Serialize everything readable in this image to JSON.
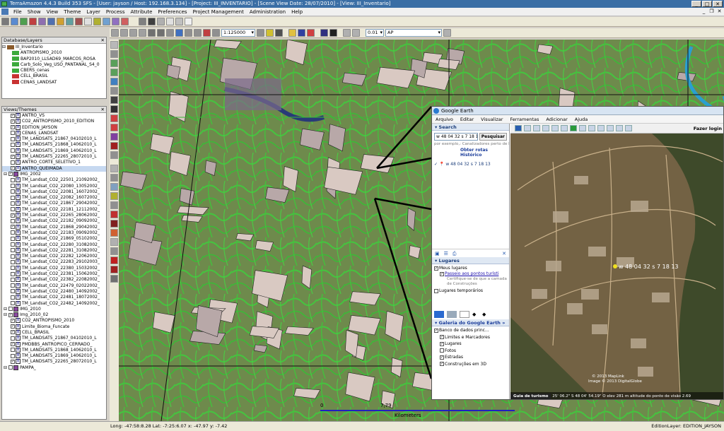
{
  "app": {
    "title": "TerraAmazon 4.4.3 Build 353 SFS - [User: jayson / Host: 192.168.3.134] - [Project: III_INVENTARIO] - [Scene View Date: 28/07/2010] - [View: III_Inventario]",
    "window_buttons": [
      "_",
      "□",
      "✕"
    ],
    "mdi_buttons": [
      "_",
      "❐",
      "✕"
    ]
  },
  "menu": [
    "File",
    "Show",
    "View",
    "Theme",
    "Layer",
    "Process",
    "Attribute",
    "Preferences",
    "Project Management",
    "Administration",
    "Help"
  ],
  "toolbar": {
    "scale": "1:125000",
    "step": "0.01",
    "state": "AP"
  },
  "database_panel": {
    "title": "Database/Layers",
    "close": "✕",
    "root": "III_Inventario",
    "layers": [
      "ANTROPISMO_2010",
      "BAP2010_LLSAD69_MARCOS_ROSA",
      "Carb_Solo_Veg_USO_PANTANAL_S4_0",
      "CBERS_cenas",
      "CELL_BRASIL",
      "CENAS_LANDSAT"
    ]
  },
  "views_panel": {
    "title": "Views/Themes",
    "close": "✕",
    "themes": [
      {
        "label": "ANTRO_VS",
        "checked": true,
        "indent": 1
      },
      {
        "label": "CO2_ANTROPISMO_2010_EDITION",
        "checked": true,
        "indent": 1
      },
      {
        "label": "EDITION_JAYSON",
        "checked": true,
        "indent": 1
      },
      {
        "label": "CENAS_LANDSAT",
        "checked": false,
        "indent": 1
      },
      {
        "label": "TM_LANDSAT5_21867_04102010_L",
        "checked": false,
        "indent": 1
      },
      {
        "label": "TM_LANDSAT5_21868_14062010_L",
        "checked": false,
        "indent": 1
      },
      {
        "label": "TM_LANDSAT5_21869_14062010_L",
        "checked": false,
        "indent": 1
      },
      {
        "label": "TM_LANDSAT5_22265_28072010_L",
        "checked": true,
        "indent": 1
      },
      {
        "label": "ANTRO_CORTE_SELETIVO_1",
        "checked": false,
        "indent": 1
      },
      {
        "label": "ANTRO_QUEIMADA",
        "checked": true,
        "indent": 1
      },
      {
        "label": "IMG_2002",
        "checked": true,
        "indent": 0,
        "group": true
      },
      {
        "label": "TM_Landsat_CO2_22501_21092002_",
        "checked": false,
        "indent": 1
      },
      {
        "label": "TM_Landsat_CO2_22080_13052002_",
        "checked": false,
        "indent": 1
      },
      {
        "label": "TM_Landsat_CO2_22081_16072002_",
        "checked": false,
        "indent": 1
      },
      {
        "label": "TM_Landsat_CO2_22082_16072002_",
        "checked": false,
        "indent": 1
      },
      {
        "label": "TM_Landsat_CO2_21867_29042002_",
        "checked": false,
        "indent": 1
      },
      {
        "label": "TM_Landsat_CO2_22181_12112002_",
        "checked": false,
        "indent": 1
      },
      {
        "label": "TM_Landsat_CO2_22265_28062002_",
        "checked": true,
        "indent": 1
      },
      {
        "label": "TM_Landsat_CO2_22182_09092002_",
        "checked": false,
        "indent": 1
      },
      {
        "label": "TM_Landsat_CO2_21868_29042002_",
        "checked": true,
        "indent": 1
      },
      {
        "label": "TM_Landsat_CO2_22183_09092002_",
        "checked": false,
        "indent": 1
      },
      {
        "label": "TM_Landsat_CO2_21869_05102002_",
        "checked": false,
        "indent": 1
      },
      {
        "label": "TM_Landsat_CO2_22280_31082002_",
        "checked": false,
        "indent": 1
      },
      {
        "label": "TM_Landsat_CO2_22281_31082002_",
        "checked": false,
        "indent": 1
      },
      {
        "label": "TM_Landsat_CO2_22282_12062002_",
        "checked": false,
        "indent": 1
      },
      {
        "label": "TM_Landsat_CO2_22283_29102003_",
        "checked": false,
        "indent": 1
      },
      {
        "label": "TM_Landsat_CO2_22380_15032002_",
        "checked": false,
        "indent": 1
      },
      {
        "label": "TM_Landsat_CO2_22381_15062002_",
        "checked": false,
        "indent": 1
      },
      {
        "label": "TM_Landsat_CO2_22382_22082002_",
        "checked": false,
        "indent": 1
      },
      {
        "label": "TM_Landsat_CO2_22479_02022002_",
        "checked": false,
        "indent": 1
      },
      {
        "label": "TM_Landsat_CO2_22480_14092002_",
        "checked": false,
        "indent": 1
      },
      {
        "label": "TM_Landsat_CO2_22481_18072002_",
        "checked": false,
        "indent": 1
      },
      {
        "label": "TM_Landsat_CO2_22482_14092002_",
        "checked": false,
        "indent": 1
      },
      {
        "label": "IMG_2010",
        "checked": false,
        "indent": 0,
        "group": true
      },
      {
        "label": "Img_2010_02",
        "checked": true,
        "indent": 0,
        "group": true
      },
      {
        "label": "CO2_ANTROPISMO_2010",
        "checked": true,
        "indent": 1
      },
      {
        "label": "Limite_Bioma_Funcate",
        "checked": true,
        "indent": 1
      },
      {
        "label": "CELL_BRASIL",
        "checked": true,
        "indent": 1
      },
      {
        "label": "TM_LANDSAT5_21867_04102010_L",
        "checked": false,
        "indent": 1
      },
      {
        "label": "PMDBBS_ANTROPICO_CERRADO_",
        "checked": true,
        "indent": 1
      },
      {
        "label": "TM_LANDSAT5_21868_14062010_L",
        "checked": false,
        "indent": 1
      },
      {
        "label": "TM_LANDSAT5_21869_14062010_L",
        "checked": false,
        "indent": 1
      },
      {
        "label": "TM_LANDSAT5_22265_28072010_L",
        "checked": true,
        "indent": 1
      },
      {
        "label": "PAMPA_",
        "checked": false,
        "indent": 0,
        "group": true
      }
    ]
  },
  "map": {
    "scale_ticks": [
      "0",
      "7,79"
    ],
    "scale_unit": "Kilometers",
    "colors": {
      "land": "#6b8a4a",
      "vegetation": "#3fbf3f",
      "cleared": "#d8c8c0",
      "water": "#283a78",
      "grid": "#111111"
    }
  },
  "google_earth": {
    "title": "Google Earth",
    "window_buttons": [
      "_",
      "□",
      "✕"
    ],
    "menu": [
      "Arquivo",
      "Editar",
      "Visualizar",
      "Ferramentas",
      "Adicionar",
      "Ajuda"
    ],
    "login": "Fazer login",
    "search": {
      "header": "Search",
      "value": "w 48 04 32 s 7 18 13",
      "button": "Pesquisar",
      "hint": "por exemplo,: Canalizadores perto de Le",
      "routes": "Obter rotas",
      "history": "Histórico",
      "result": "w 48 04 32 s 7 18 13"
    },
    "places": {
      "header": "Lugares",
      "items": [
        "Meus lugares",
        "Passeio aos pontos turísti",
        "Certifique-se de que a camada de Construções",
        "Lugares temporários"
      ]
    },
    "layers": {
      "gallery": "Galeria do Google Earth",
      "items": [
        "Banco de dados princ...",
        "Limites e Marcadores",
        "Lugares",
        "Fotos",
        "Estradas",
        "Construções em 3D"
      ]
    },
    "placemark": "w 48 04 32 s 7 18 13",
    "copyright": [
      "© 2013 MapLink",
      "Image © 2013 DigitalGlobe"
    ],
    "tour": "Guia de turismo",
    "status": "25' 06.2\" S  48 04' 54.19\" O  elev  281 m    altitude do ponto de visão  2.69"
  },
  "status": {
    "coords": "Long: -47:58:8.28  Lat: -7:25:6.07  x: -47.97  y: -7.42",
    "edition_layer": "EditionLayer: EDITION_JAYSON"
  }
}
